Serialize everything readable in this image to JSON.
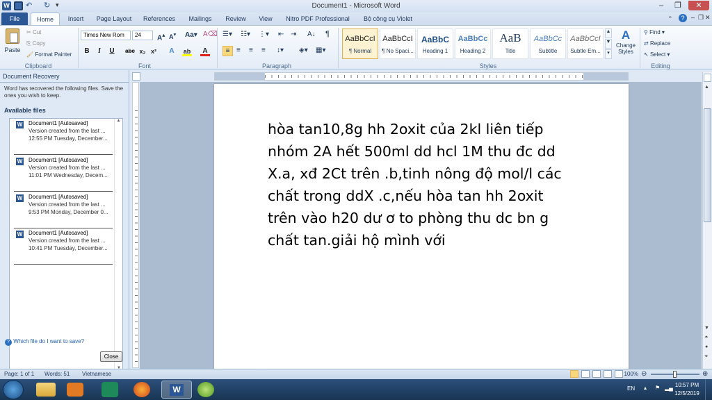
{
  "window": {
    "title": "Document1 - Microsoft Word"
  },
  "tabs": [
    "File",
    "Home",
    "Insert",
    "Page Layout",
    "References",
    "Mailings",
    "Review",
    "View",
    "Nitro PDF Professional",
    "Bộ công cụ Violet"
  ],
  "clipboard": {
    "paste": "Paste",
    "cut": "Cut",
    "copy": "Copy",
    "format_painter": "Format Painter",
    "label": "Clipboard"
  },
  "font": {
    "name": "Times New Rom",
    "size": "24",
    "label": "Font"
  },
  "paragraph": {
    "label": "Paragraph"
  },
  "styles": {
    "label": "Styles",
    "items": [
      {
        "preview": "AaBbCcI",
        "name": "¶ Normal"
      },
      {
        "preview": "AaBbCcI",
        "name": "¶ No Spaci..."
      },
      {
        "preview": "AaBbC",
        "name": "Heading 1"
      },
      {
        "preview": "AaBbCc",
        "name": "Heading 2"
      },
      {
        "preview": "AaB",
        "name": "Title"
      },
      {
        "preview": "AaBbCc",
        "name": "Subtitle"
      },
      {
        "preview": "AaBbCcI",
        "name": "Subtle Em..."
      }
    ],
    "change_styles": "Change Styles"
  },
  "editing": {
    "find": "Find",
    "replace": "Replace",
    "select": "Select",
    "label": "Editing"
  },
  "recovery": {
    "title": "Document Recovery",
    "message": "Word has recovered the following files.  Save the ones you wish to keep.",
    "available": "Available files",
    "files": [
      {
        "name": "Document1  [Autosaved]",
        "desc": "Version created from the last ...",
        "time": "12:55 PM Tuesday, December..."
      },
      {
        "name": "Document1  [Autosaved]",
        "desc": "Version created from the last ...",
        "time": "11:01 PM Wednesday, Decem..."
      },
      {
        "name": "Document1  [Autosaved]",
        "desc": "Version created from the last ...",
        "time": "9:53 PM Monday, December 0..."
      },
      {
        "name": "Document1  [Autosaved]",
        "desc": "Version created from the last ...",
        "time": "10:41 PM Tuesday, December..."
      }
    ],
    "help": "Which file do I want to save?",
    "close": "Close"
  },
  "document": {
    "lines": [
      "hòa tan10,8g hh 2oxit của 2kl liên tiếp",
      "nhóm 2A hết 500ml dd hcl 1M thu đc dd",
      "X.a, xđ 2Ct trên .b,tinh nông độ mol/l các",
      "chất trong ddX .c,nếu hòa tan hh 2oxit",
      "trên vào h20 dư ơ to phòng thu dc bn g",
      "chất tan.giải hộ mình với"
    ]
  },
  "status": {
    "page": "Page: 1 of 1",
    "words": "Words: 51",
    "language": "Vietnamese",
    "zoom": "100%"
  },
  "taskbar": {
    "lang": "EN",
    "time": "10:57 PM",
    "date": "12/5/2019"
  }
}
